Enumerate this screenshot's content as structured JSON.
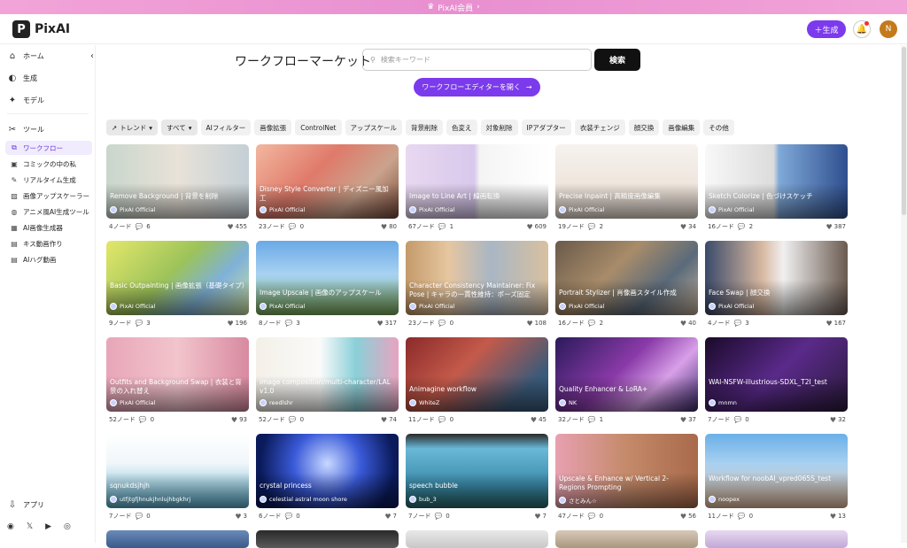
{
  "banner": {
    "label": "PixAI会員",
    "crown_icon": "crown-icon",
    "color": "#ec8fd3"
  },
  "header": {
    "logo_text": "PixAI",
    "logo_mark": "P",
    "generate_label": "＋生成",
    "avatar_initial": "N",
    "accent": "#7c3aed"
  },
  "sidebar": {
    "main": [
      {
        "label": "ホーム",
        "icon": "home-icon"
      },
      {
        "label": "生成",
        "icon": "palette-icon"
      },
      {
        "label": "モデル",
        "icon": "wand-icon"
      }
    ],
    "tools_label": "ツール",
    "tools": [
      {
        "label": "ワークフロー",
        "icon": "workflow-icon",
        "active": true
      },
      {
        "label": "コミックの中の私",
        "icon": "comic-icon"
      },
      {
        "label": "リアルタイム生成",
        "icon": "brush-icon"
      },
      {
        "label": "画像アップスケーラー",
        "icon": "image-icon"
      },
      {
        "label": "アニメ風AI生成ツール",
        "icon": "globe-icon"
      },
      {
        "label": "AI画像生成器",
        "icon": "ai-icon"
      },
      {
        "label": "キス動画作り",
        "icon": "video-icon"
      },
      {
        "label": "AIハグ動画",
        "icon": "video-icon"
      }
    ],
    "app_label": "アプリ"
  },
  "main": {
    "title": "ワークフローマーケット",
    "search_placeholder": "検索キーワード",
    "search_button": "検索",
    "editor_button": "ワークフローエディターを開く",
    "sort_label": "トレンド",
    "scope_label": "すべて",
    "filters": [
      "AIフィルター",
      "画像拡張",
      "ControlNet",
      "アップスケール",
      "背景削除",
      "色変え",
      "対象削除",
      "IPアダプター",
      "衣装チェンジ",
      "顔交換",
      "画像編集",
      "その他"
    ]
  },
  "cards": [
    {
      "title": "Remove Background | 背景を削除",
      "author": "PixAI Official",
      "nodes": "4ノード",
      "comments": "6",
      "likes": "455",
      "bg": "linear-gradient(90deg,#c9d6cc 0%,#e8e2d8 50%,#c4cfd6 100%)"
    },
    {
      "title": "Disney Style Converter | ディズニー風加工",
      "author": "PixAI Official",
      "nodes": "23ノード",
      "comments": "0",
      "likes": "80",
      "bg": "linear-gradient(135deg,#f2b8a0,#e07a6a 40%,#caa38c 70%,#7a4a3a)"
    },
    {
      "title": "Image to Line Art | 線画転換",
      "author": "PixAI Official",
      "nodes": "67ノード",
      "comments": "1",
      "likes": "609",
      "bg": "linear-gradient(90deg,#e8d8f0 0%,#d8c8ec 48%,#f4f4f4 52%,#ffffff 100%)"
    },
    {
      "title": "Precise Inpaint | 高精度画像編集",
      "author": "PixAI Official",
      "nodes": "19ノード",
      "comments": "2",
      "likes": "34",
      "bg": "linear-gradient(180deg,#f6f2ee,#e9dcd0)"
    },
    {
      "title": "Sketch Colorize | 色づけスケッチ",
      "author": "PixAI Official",
      "nodes": "16ノード",
      "comments": "2",
      "likes": "387",
      "bg": "linear-gradient(90deg,#f8f8f8 0%,#dcdcdc 48%,#7fa9d8 52%,#2f4f8f 100%)"
    },
    {
      "title": "Basic Outpainting | 画像拡張（基礎タイプ）",
      "author": "PixAI Official",
      "nodes": "9ノード",
      "comments": "3",
      "likes": "196",
      "bg": "linear-gradient(135deg,#e4e76a,#9cc35a 45%,#7fb1d8 70%,#cfe3a0)"
    },
    {
      "title": "Image Upscale | 画像のアップスケール",
      "author": "PixAI Official",
      "nodes": "8ノード",
      "comments": "3",
      "likes": "317",
      "bg": "linear-gradient(180deg,#6aa9e6 0%,#a8d2f2 45%,#7cae5a 100%)"
    },
    {
      "title": "Character Consistency Maintainer: Fix Pose | キャラの一貫性維持：ポーズ固定",
      "author": "PixAI Official",
      "nodes": "23ノード",
      "comments": "0",
      "likes": "108",
      "bg": "linear-gradient(90deg,#c49a6a,#e6c6a0 30%,#a9b6c4 60%,#d8c0a0)"
    },
    {
      "title": "Portrait Stylizer | 肖像画スタイル作成",
      "author": "PixAI Official",
      "nodes": "16ノード",
      "comments": "2",
      "likes": "40",
      "bg": "linear-gradient(135deg,#6a5a4a,#a88c6a 40%,#5a6a7a 70%,#c4b09a)"
    },
    {
      "title": "Face Swap | 顔交換",
      "author": "PixAI Official",
      "nodes": "4ノード",
      "comments": "3",
      "likes": "167",
      "bg": "linear-gradient(90deg,#3a4a6a,#d8b8a0 40%,#f0f0f0 55%,#6a5a50)"
    },
    {
      "title": "Outfits and Background Swap | 衣装と背景の入れ替え",
      "author": "PixAI Official",
      "nodes": "52ノード",
      "comments": "0",
      "likes": "93",
      "bg": "linear-gradient(90deg,#e8a6b8,#f2c4cc 50%,#d88aa0)"
    },
    {
      "title": "image composition/multi-character/LAL v1.0",
      "author": "reedlshr",
      "nodes": "52ノード",
      "comments": "0",
      "likes": "74",
      "bg": "linear-gradient(90deg,#f4f0e8 0%,#fafafa 45%,#8ad0d8 70%,#e8a4c0)"
    },
    {
      "title": "Animagine workflow",
      "author": "WhiteZ",
      "nodes": "11ノード",
      "comments": "0",
      "likes": "45",
      "bg": "linear-gradient(135deg,#8a2a2a,#c45a4a 40%,#3a5a7a 80%)"
    },
    {
      "title": "Quality Enhancer & LoRA+",
      "author": "NK",
      "nodes": "32ノード",
      "comments": "1",
      "likes": "37",
      "bg": "linear-gradient(135deg,#2a1a5a,#8a3aa8 45%,#d8a0e8 70%,#3a2a6a)"
    },
    {
      "title": "WAI-NSFW-illustrious-SDXL_T2I_test",
      "author": "mnmn",
      "nodes": "7ノード",
      "comments": "0",
      "likes": "32",
      "bg": "linear-gradient(135deg,#1a0a2a,#5a2a8a 50%,#2a1a3a)"
    },
    {
      "title": "sqnukdsjhjh",
      "author": "utfjtgfjhnukjhnlujhbgkhrj",
      "nodes": "7ノード",
      "comments": "0",
      "likes": "3",
      "bg": "linear-gradient(180deg,#ffffff 0%,#f0f6fa 40%,#5ab0d0 100%)"
    },
    {
      "title": "crystal princess",
      "author": "celestial astral moon shore",
      "nodes": "6ノード",
      "comments": "0",
      "likes": "7",
      "bg": "radial-gradient(circle at 50% 40%,#c8d8ff,#3a5ad8 40%,#0a1a5a 80%)"
    },
    {
      "title": "speech bubble",
      "author": "bub_3",
      "nodes": "7ノード",
      "comments": "0",
      "likes": "7",
      "bg": "linear-gradient(180deg,#2a2a2a 0%,#6ab8d8 20%,#3a8aa8 70%,#2a6a6a)"
    },
    {
      "title": "Upscale & Enhance w/ Vertical 2-Regions Prompting",
      "author": "さとみん☆",
      "nodes": "47ノード",
      "comments": "0",
      "likes": "56",
      "bg": "linear-gradient(90deg,#e8a0b0,#c48a6a 50%,#a86a4a)"
    },
    {
      "title": "Workflow for noobAI_vpred065S_test",
      "author": "noopex",
      "nodes": "11ノード",
      "comments": "0",
      "likes": "13",
      "bg": "linear-gradient(180deg,#6ab0e8 0%,#a8d0f0 40%,#e8c0a0 100%)"
    }
  ],
  "peek_row": [
    {
      "bg": "linear-gradient(180deg,#6a8ab8,#3a5a8a)"
    },
    {
      "bg": "linear-gradient(180deg,#2a2a2a,#5a5a5a)"
    },
    {
      "bg": "linear-gradient(180deg,#e8e8e8,#c8c8c8)"
    },
    {
      "bg": "linear-gradient(180deg,#d8c8b8,#a89880)"
    },
    {
      "bg": "linear-gradient(180deg,#e8d8f0,#c0a8d8)"
    }
  ]
}
